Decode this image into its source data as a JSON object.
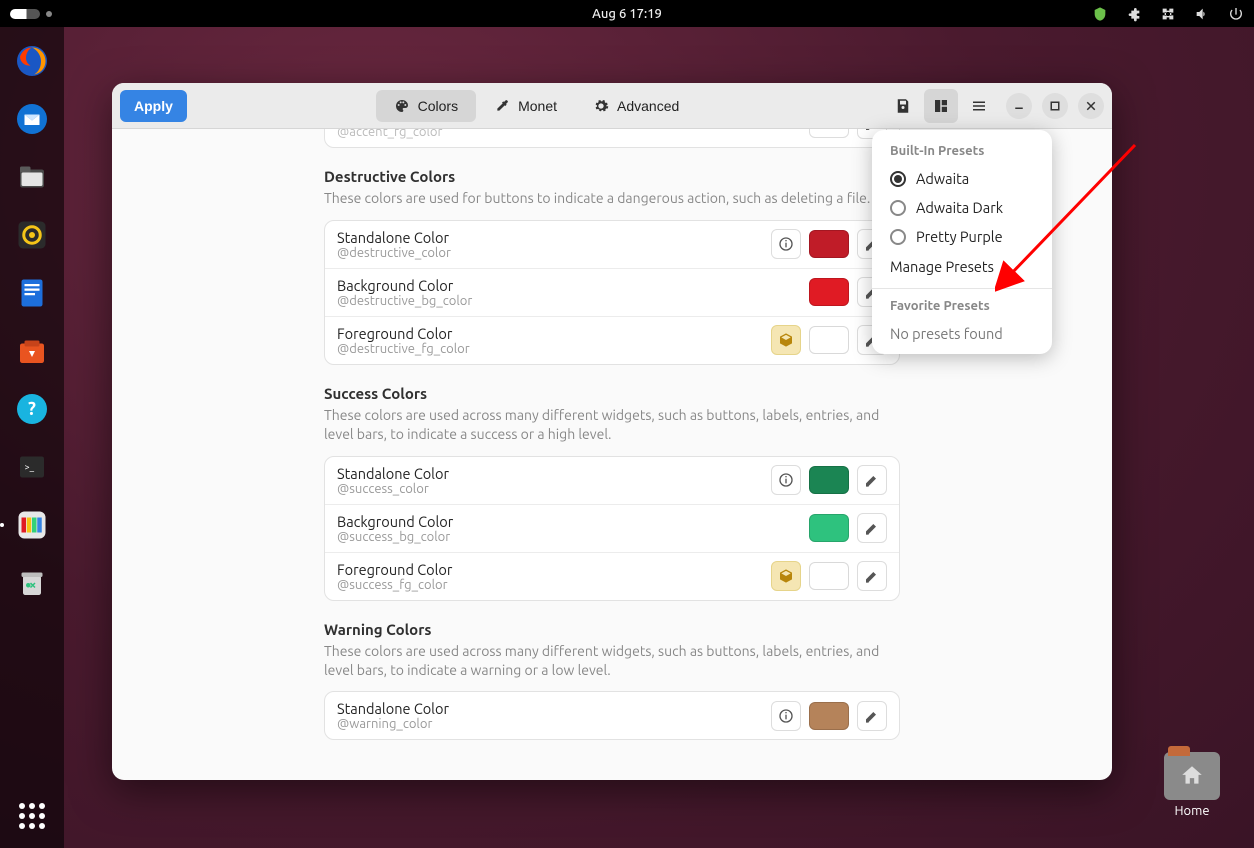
{
  "topbar": {
    "datetime": "Aug 6  17:19"
  },
  "dock": {
    "items": [
      "firefox",
      "thunderbird",
      "files",
      "rhythmbox",
      "writer",
      "software",
      "help",
      "terminal",
      "gradience",
      "trash"
    ]
  },
  "desktop": {
    "home_label": "Home"
  },
  "window": {
    "apply_label": "Apply",
    "tabs": {
      "colors": "Colors",
      "monet": "Monet",
      "advanced": "Advanced"
    }
  },
  "popover": {
    "builtin_header": "Built-In Presets",
    "options": [
      {
        "label": "Adwaita",
        "checked": true
      },
      {
        "label": "Adwaita Dark",
        "checked": false
      },
      {
        "label": "Pretty Purple",
        "checked": false
      }
    ],
    "manage": "Manage Presets",
    "favorite_header": "Favorite Presets",
    "empty": "No presets found"
  },
  "sections": {
    "destructive": {
      "title": "Destructive Colors",
      "desc": "These colors are used for buttons to indicate a dangerous action, such as deleting a file.",
      "rows": [
        {
          "title": "Standalone Color",
          "sub": "@destructive_color",
          "info": true,
          "warn": false,
          "swatch": "#c01c28"
        },
        {
          "title": "Background Color",
          "sub": "@destructive_bg_color",
          "info": false,
          "warn": false,
          "swatch": "#e01b24"
        },
        {
          "title": "Foreground Color",
          "sub": "@destructive_fg_color",
          "info": false,
          "warn": true,
          "swatch": "#ffffff"
        }
      ]
    },
    "success": {
      "title": "Success Colors",
      "desc": "These colors are used across many different widgets, such as buttons, labels, entries, and level bars, to indicate a success or a high level.",
      "rows": [
        {
          "title": "Standalone Color",
          "sub": "@success_color",
          "info": true,
          "warn": false,
          "swatch": "#1b8553"
        },
        {
          "title": "Background Color",
          "sub": "@success_bg_color",
          "info": false,
          "warn": false,
          "swatch": "#2ec27e"
        },
        {
          "title": "Foreground Color",
          "sub": "@success_fg_color",
          "info": false,
          "warn": true,
          "swatch": "#ffffff"
        }
      ]
    },
    "warning": {
      "title": "Warning Colors",
      "desc": "These colors are used across many different widgets, such as buttons, labels, entries, and level bars, to indicate a warning or a low level.",
      "rows": [
        {
          "title": "Standalone Color",
          "sub": "@warning_color",
          "info": true,
          "warn": false,
          "swatch": "#b5835a"
        }
      ]
    }
  }
}
